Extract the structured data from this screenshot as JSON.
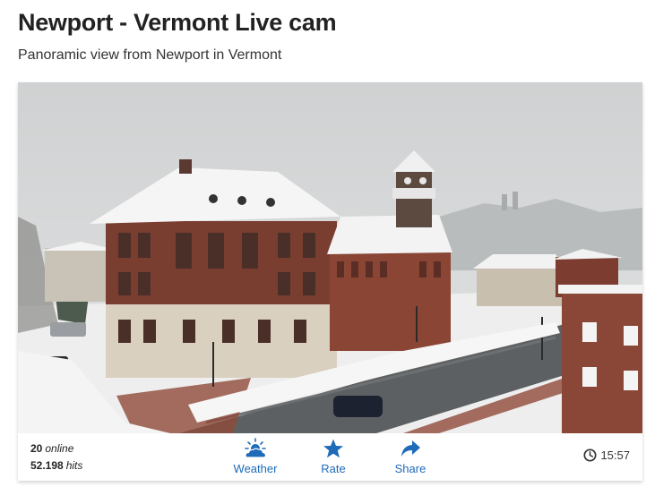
{
  "page": {
    "title": "Newport - Vermont Live cam",
    "subtitle": "Panoramic view from Newport in Vermont"
  },
  "webcam": {
    "image_alt": "Live webcam image of snowy downtown Newport, Vermont",
    "stats": {
      "online_count": "20",
      "online_label": "online",
      "hits_count": "52.198",
      "hits_label": "hits"
    },
    "actions": [
      {
        "label": "Weather",
        "icon": "weather-icon"
      },
      {
        "label": "Rate",
        "icon": "star-icon"
      },
      {
        "label": "Share",
        "icon": "share-icon"
      }
    ],
    "time": "15:57"
  },
  "colors": {
    "accent": "#1e6bb8",
    "brick": "#7a3a2c",
    "snow": "#f2f2f2",
    "sky": "#d3d5d6"
  }
}
